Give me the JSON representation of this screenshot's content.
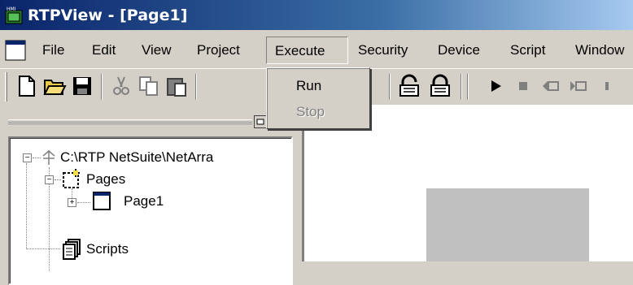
{
  "window": {
    "title": "RTPView - [Page1]",
    "icon_text": "HMI",
    "icon": "hmi-app-icon"
  },
  "menu": {
    "items": [
      {
        "label": "File"
      },
      {
        "label": "Edit"
      },
      {
        "label": "View"
      },
      {
        "label": "Project"
      },
      {
        "label": "Execute"
      },
      {
        "label": "Security"
      },
      {
        "label": "Device"
      },
      {
        "label": "Script"
      },
      {
        "label": "Window"
      }
    ],
    "open_menu": "Execute",
    "dropdown": [
      {
        "label": "Run",
        "enabled": true
      },
      {
        "label": "Stop",
        "enabled": false
      }
    ]
  },
  "toolbar": {
    "buttons": [
      "new-file-icon",
      "open-folder-icon",
      "save-icon",
      "cut-icon",
      "copy-icon",
      "paste-icon",
      "lock-open-icon",
      "lock-closed-icon",
      "play-icon",
      "stop-icon",
      "step-back-icon",
      "step-forward-icon"
    ]
  },
  "tree": {
    "root": {
      "label": "C:\\RTP NetSuite\\NetArra"
    },
    "pages": {
      "label": "Pages"
    },
    "page1": {
      "label": "Page1"
    },
    "scripts": {
      "label": "Scripts"
    },
    "expand_glyph": "+",
    "collapse_glyph": "−"
  },
  "colors": {
    "titlebar_start": "#0a246a",
    "titlebar_end": "#a6caf0",
    "face": "#d4d0c8",
    "canvas_rect": "#c0c0c0"
  }
}
